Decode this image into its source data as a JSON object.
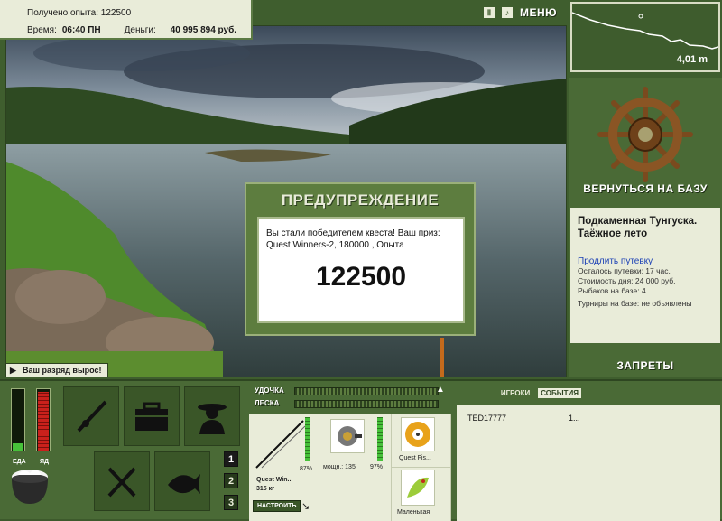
{
  "info": {
    "exp_label": "Получено опыта:",
    "exp_value": "122500",
    "time_label": "Время:",
    "time_value": "06:40 ПН",
    "money_label": "Деньги:",
    "money_value": "40 995 894 руб."
  },
  "controls": {
    "pause_icon": "pause-icon",
    "sound_icon": "sound-icon",
    "menu_label": "МЕНЮ"
  },
  "depth": {
    "value": "4,01 m"
  },
  "right": {
    "return_label": "ВЕРНУТЬСЯ НА БАЗУ",
    "base_name": "Подкаменная Тунгуска. Таёжное лето",
    "extend_link": "Продлить путевку",
    "lines": [
      "Осталось путевки: 17 час.",
      "Стоимость дня: 24 000 руб.",
      "Рыбаков на базе: 4",
      "Турниры на базе: не объявлены"
    ],
    "bans_label": "ЗАПРЕТЫ"
  },
  "dialog": {
    "title": "ПРЕДУПРЕЖДЕНИЕ",
    "message": "Вы стали победителем квеста! Ваш приз: Quest Winners-2, 180000 , Опыта",
    "prize": "122500"
  },
  "toast": {
    "text": "Ваш разряд вырос!"
  },
  "meters": {
    "food_label": "ЕДА",
    "poison_label": "ЯД",
    "food_level": 0.12,
    "poison_level": 0.96
  },
  "slots": [
    "1",
    "2",
    "3"
  ],
  "rod": {
    "rod_label": "УДОЧКА",
    "line_label": "ЛЕСКА",
    "rod_name": "Quest Win...",
    "rod_weight": "315 кг",
    "rod_percent": "87%",
    "reel_power": "мощн.: 135",
    "reel_percent": "97%",
    "line_name": "Quest Fis...",
    "bait_name": "Маленькая",
    "tune_label": "НАСТРОИТЬ"
  },
  "events": {
    "tab_players": "ИГРОКИ",
    "tab_events": "СОБЫТИЯ",
    "rows": [
      {
        "who": "TED17777",
        "what": "1..."
      }
    ]
  }
}
